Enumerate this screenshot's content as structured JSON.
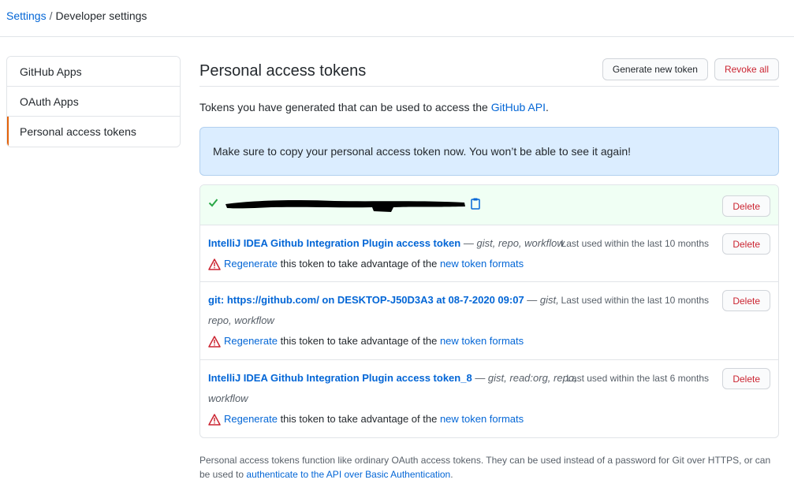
{
  "breadcrumb": {
    "settings": "Settings",
    "separator": "/",
    "current": "Developer settings"
  },
  "sidebar": {
    "items": [
      {
        "label": "GitHub Apps"
      },
      {
        "label": "OAuth Apps"
      },
      {
        "label": "Personal access tokens",
        "selected": true
      }
    ]
  },
  "header": {
    "title": "Personal access tokens",
    "generate_label": "Generate new token",
    "revoke_label": "Revoke all"
  },
  "description": {
    "text": "Tokens you have generated that can be used to access the ",
    "link": "GitHub API",
    "end": "."
  },
  "flash": {
    "text": "Make sure to copy your personal access token now. You won’t be able to see it again!"
  },
  "new_token": {
    "delete_label": "Delete",
    "icons": [
      "check-icon",
      "clipboard-icon"
    ]
  },
  "tokens": [
    {
      "name": "IntelliJ IDEA Github Integration Plugin access token",
      "scopes": " — gist, repo, workflow",
      "last_used": "Last used within the last 10 months",
      "regenerate": "Regenerate",
      "warning": " this token to take advantage of the ",
      "formats_link": "new token formats",
      "delete_label": "Delete"
    },
    {
      "name": "git: https://github.com/ on DESKTOP-J50D3A3 at 08-7-2020 09:07",
      "scopes_line1": " — gist,",
      "scopes_line2": "repo, workflow",
      "last_used": "Last used within the last 10 months",
      "regenerate": "Regenerate",
      "warning": " this token to take advantage of the ",
      "formats_link": "new token formats",
      "delete_label": "Delete"
    },
    {
      "name": "IntelliJ IDEA Github Integration Plugin access token_8",
      "scopes_line1": " — gist, read:org, repo,",
      "scopes_line2": "workflow",
      "last_used": "Last used within the last 6 months",
      "regenerate": "Regenerate",
      "warning": " this token to take advantage of the ",
      "formats_link": "new token formats",
      "delete_label": "Delete"
    }
  ],
  "footer": {
    "text": "Personal access tokens function like ordinary OAuth access tokens. They can be used instead of a password for Git over HTTPS, or can be used to ",
    "link": "authenticate to the API over Basic Authentication",
    "end": "."
  },
  "colors": {
    "link": "#0366d6",
    "danger": "#cb2431",
    "success": "#28a745",
    "flash_bg": "#dbedff",
    "new_token_bg": "#f0fff4",
    "selected_border": "#e36209"
  }
}
